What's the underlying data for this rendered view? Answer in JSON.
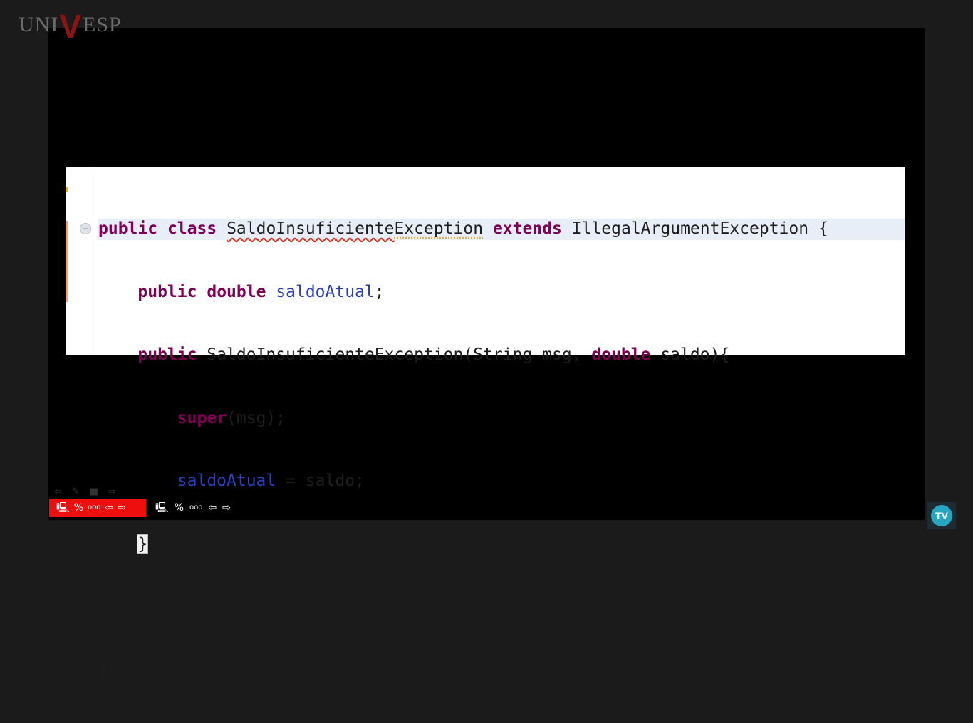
{
  "logo": {
    "prefix": "UNI",
    "v": "V",
    "suffix": "ESP"
  },
  "code": {
    "line1": {
      "kw1": "public",
      "kw2": "class",
      "class_err": "SaldoInsuficiente",
      "class_rest": "Exception",
      "kw3": "extends",
      "parent": "IllegalArgumentException",
      "brace": "{"
    },
    "line2": {
      "kw1": "public",
      "kw2": "double",
      "field": "saldoAtual",
      "end": ";"
    },
    "line3": {
      "kw1": "public",
      "ctor": "SaldoInsuficienteException(String msg, ",
      "kw2": "double",
      "rest": " saldo){"
    },
    "line4": {
      "kw": "super",
      "rest": "(msg);"
    },
    "line5": {
      "field": "saldoAtual",
      "rest": " = saldo;"
    },
    "line6": {
      "brace": "}"
    },
    "line8": {
      "brace": "}"
    }
  },
  "badge": {
    "label": "TV"
  },
  "icons": {
    "fold": "fold-collapse-icon",
    "monitor": "monitor-icon",
    "percent": "percent-icon",
    "dots": "dots-icon",
    "prev": "arrow-left-icon",
    "next": "arrow-right-icon"
  },
  "colors": {
    "keyword": "#7f0055",
    "field": "#2a3fbd",
    "error_underline": "#d73a2a",
    "toolbar_red": "#ee0e0e",
    "tv_teal": "#26a7bf"
  }
}
